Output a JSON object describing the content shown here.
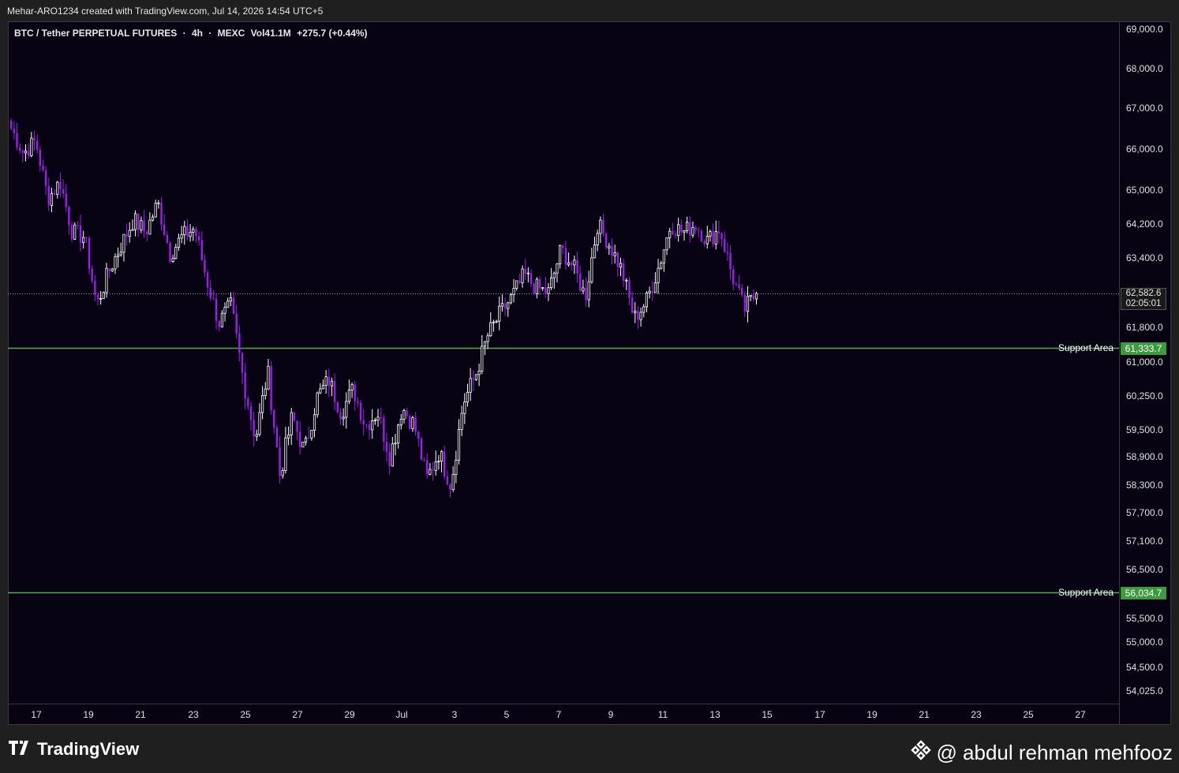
{
  "header": {
    "created_by": "Mehar-ARO1234 created with TradingView.com, Jul 14, 2026 14:54 UTC+5"
  },
  "symbol": {
    "name": "BTC / Tether PERPETUAL FUTURES",
    "sep1": "·",
    "interval": "4h",
    "sep2": "·",
    "exchange": "MEXC",
    "volume": "Vol41.1M",
    "change": "+275.7 (+0.44%)"
  },
  "price_axis": {
    "ticks": [
      {
        "label": "69,000.0",
        "value": 69000
      },
      {
        "label": "68,000.0",
        "value": 68000
      },
      {
        "label": "67,000.0",
        "value": 67000
      },
      {
        "label": "66,000.0",
        "value": 66000
      },
      {
        "label": "65,000.0",
        "value": 65000
      },
      {
        "label": "64,200.0",
        "value": 64200
      },
      {
        "label": "63,400.0",
        "value": 63400
      },
      {
        "label": "61,800.0",
        "value": 61800
      },
      {
        "label": "61,000.0",
        "value": 61000
      },
      {
        "label": "60,250.0",
        "value": 60250
      },
      {
        "label": "59,500.0",
        "value": 59500
      },
      {
        "label": "58,900.0",
        "value": 58900
      },
      {
        "label": "58,300.0",
        "value": 58300
      },
      {
        "label": "57,700.0",
        "value": 57700
      },
      {
        "label": "57,100.0",
        "value": 57100
      },
      {
        "label": "56,500.0",
        "value": 56500
      },
      {
        "label": "55,500.0",
        "value": 55500
      },
      {
        "label": "55,000.0",
        "value": 55000
      },
      {
        "label": "54,500.0",
        "value": 54500
      },
      {
        "label": "54,025.0",
        "value": 54025
      }
    ],
    "current_price": "62,582.6",
    "countdown": "02:05:01"
  },
  "time_axis": {
    "ticks": [
      "17",
      "19",
      "21",
      "23",
      "25",
      "27",
      "29",
      "Jul",
      "3",
      "5",
      "7",
      "9",
      "11",
      "13",
      "15",
      "17",
      "19",
      "21",
      "23",
      "25",
      "27"
    ]
  },
  "support_lines": [
    {
      "label": "Support Area",
      "price_label": "61,333.7",
      "value": 61333.7
    },
    {
      "label": "Support Area",
      "price_label": "56,034.7",
      "value": 56034.7
    }
  ],
  "colors": {
    "background": "#070313",
    "candle_up": "#ffffff",
    "candle_down": "#9b1fe8",
    "support": "#4caf50",
    "current_price_line": "#9a9a9a"
  },
  "chart_data": {
    "type": "candlestick",
    "interval": "4h",
    "ylim": [
      54025,
      69000
    ],
    "x_range_days": [
      "Jun 16",
      "Jul 28"
    ],
    "last_close": 62582.6,
    "ohlc_path": [
      66500,
      65900,
      66200,
      64800,
      65200,
      64000,
      63900,
      62300,
      63100,
      63700,
      64300,
      64000,
      64700,
      63500,
      63900,
      64100,
      62900,
      61900,
      62300,
      60600,
      59300,
      60800,
      58500,
      59800,
      59000,
      60200,
      60600,
      59900,
      60400,
      59600,
      59900,
      58900,
      60000,
      59600,
      58400,
      59000,
      58300,
      60100,
      60700,
      61600,
      62100,
      62500,
      63000,
      62700,
      62600,
      63600,
      63200,
      62500,
      64200,
      63700,
      63100,
      62000,
      62400,
      63200,
      64200,
      64000,
      64200,
      63800,
      64100,
      63000,
      62200,
      62582.6
    ]
  }
}
